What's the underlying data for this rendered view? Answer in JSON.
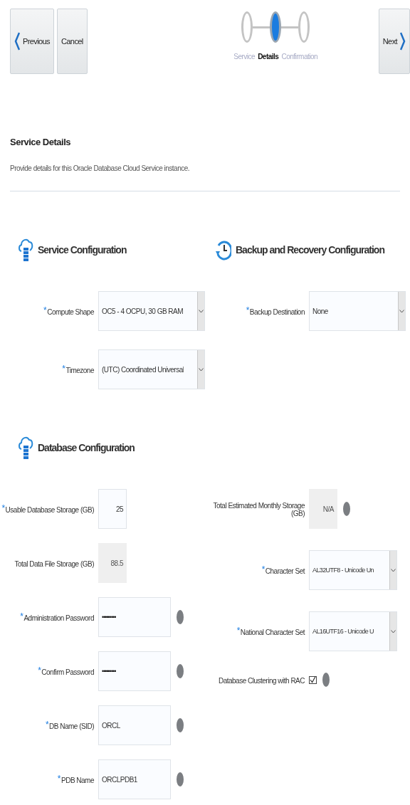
{
  "nav": {
    "previous": "Previous",
    "cancel": "Cancel",
    "next": "Next"
  },
  "steps": [
    {
      "label": "Service",
      "selected": false
    },
    {
      "label": "Details",
      "selected": true
    },
    {
      "label": "Confirmation",
      "selected": false
    }
  ],
  "page": {
    "title": "Service Details",
    "description": "Provide details for this Oracle Database Cloud Service instance."
  },
  "sections": [
    {
      "title": "Service Configuration",
      "columns": [
        [
          {
            "label": "Compute Shape",
            "required_mark": "*",
            "kind": "select",
            "value": "OC5 - 4 OCPU, 30 GB RAM",
            "help": false
          },
          {
            "label": "Timezone",
            "required_mark": "*",
            "kind": "select",
            "value": "(UTC) Coordinated Universal",
            "help": false
          }
        ]
      ]
    },
    {
      "title": "Backup and Recovery Configuration",
      "columns": [
        [
          {
            "label": "Backup Destination",
            "required_mark": "*",
            "kind": "select",
            "value": "None",
            "help": false
          }
        ]
      ]
    },
    {
      "title": "Database Configuration",
      "columns": [
        [
          {
            "label": "Usable Database Storage (GB)",
            "required_mark": "*",
            "kind": "number",
            "value": "25",
            "help": false
          },
          {
            "label": "Total Data File Storage (GB)",
            "kind": "readonly",
            "value": "88.5",
            "help": false
          },
          {
            "label": "Administration Password",
            "required_mark": "*",
            "kind": "password",
            "value": "•••••••••",
            "help": true
          },
          {
            "label": "Confirm Password",
            "required_mark": "*",
            "kind": "password",
            "value": "•••••••••",
            "help": true
          },
          {
            "label": "DB Name (SID)",
            "required_mark": "*",
            "kind": "text",
            "value": "ORCL",
            "help": true
          },
          {
            "label": "PDB Name",
            "required_mark": "*",
            "kind": "text",
            "value": "ORCLPDB1",
            "help": true
          }
        ],
        [
          {
            "label": "Total Estimated Monthly Storage (GB)",
            "kind": "readonly",
            "value": "N/A",
            "help": true
          },
          {
            "label": "Character Set",
            "required_mark": "*",
            "kind": "select",
            "value": "AL32UTF8 - Unicode Un",
            "help": false
          },
          {
            "label": "National Character Set",
            "required_mark": "*",
            "kind": "select",
            "value": "AL16UTF16 - Unicode U",
            "help": false
          },
          {
            "label": "Database Clustering with RAC",
            "kind": "checkbox",
            "checked": true,
            "help": true
          }
        ]
      ]
    }
  ]
}
